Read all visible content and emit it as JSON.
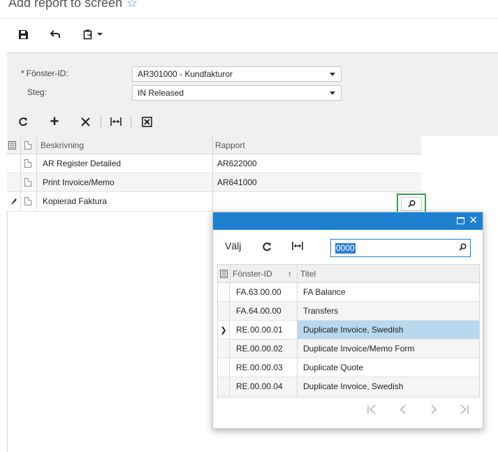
{
  "page": {
    "title": "Add report to screen"
  },
  "main_toolbar": {
    "save_icon": "floppy-disk-icon",
    "undo_icon": "undo-icon",
    "paste_icon": "clipboard-icon"
  },
  "form": {
    "screen_id_label": "Fönster-ID:",
    "screen_id_required": "*",
    "screen_id_value": "AR301000 - Kundfakturor",
    "step_label": "Steg:",
    "step_value": "IN Released"
  },
  "grid": {
    "columns": {
      "description": "Beskrivning",
      "report": "Rapport"
    },
    "rows": [
      {
        "description": "AR Register Detailed",
        "report": "AR622000"
      },
      {
        "description": "Print Invoice/Memo",
        "report": "AR641000"
      },
      {
        "description": "Kopierad Faktura",
        "report": ""
      }
    ]
  },
  "popup": {
    "select_label": "Välj",
    "search_value": "0000",
    "columns": {
      "screen_id": "Fönster-ID",
      "sort_indicator": "↑",
      "title": "Titel"
    },
    "rows": [
      {
        "screen_id": "FA.63.00.00",
        "title": "FA Balance"
      },
      {
        "screen_id": "FA.64.00.00",
        "title": "Transfers"
      },
      {
        "screen_id": "RE.00.00.01",
        "title": "Duplicate Invoice, Swedish"
      },
      {
        "screen_id": "RE.00.00.02",
        "title": "Duplicate Invoice/Memo Form"
      },
      {
        "screen_id": "RE.00.00.03",
        "title": "Duplicate Quote"
      },
      {
        "screen_id": "RE.00.00.04",
        "title": "Duplicate Invoice, Swedish"
      }
    ],
    "selected_row": 2,
    "pager": {
      "first": "|❮",
      "prev": "❮",
      "next": "❯",
      "last": "❯|"
    }
  },
  "colors": {
    "accent": "#1d80d1",
    "highlight": "#37a347",
    "selected_row": "#b8d8f0"
  }
}
